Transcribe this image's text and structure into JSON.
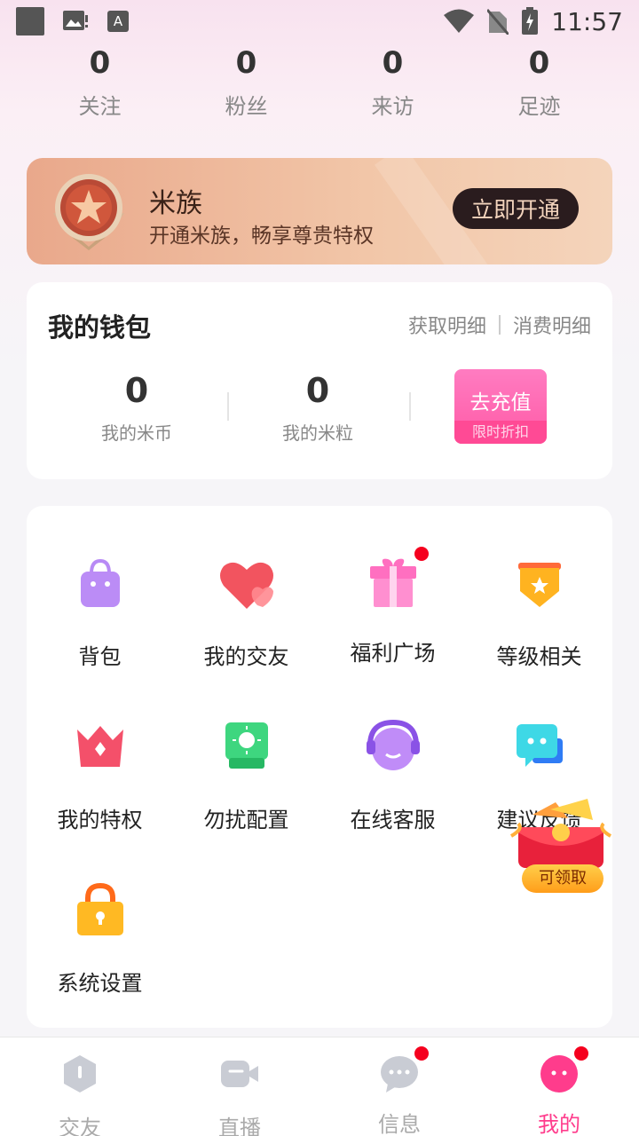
{
  "status_bar": {
    "time": "11:57"
  },
  "stats": [
    {
      "value": "0",
      "label": "关注"
    },
    {
      "value": "0",
      "label": "粉丝"
    },
    {
      "value": "0",
      "label": "来访"
    },
    {
      "value": "0",
      "label": "足迹"
    }
  ],
  "vip": {
    "title": "米族",
    "subtitle": "开通米族，畅享尊贵特权",
    "button": "立即开通"
  },
  "wallet": {
    "title": "我的钱包",
    "link_income": "获取明细",
    "link_spend": "消费明细",
    "coins_value": "0",
    "coins_label": "我的米币",
    "grains_value": "0",
    "grains_label": "我的米粒",
    "recharge_label": "去充值",
    "recharge_sub": "限时折扣"
  },
  "menu": {
    "items": [
      {
        "label": "背包",
        "icon": "bag-icon"
      },
      {
        "label": "我的交友",
        "icon": "heart-icon"
      },
      {
        "label": "福利广场",
        "icon": "gift-icon"
      },
      {
        "label": "等级相关",
        "icon": "level-badge-icon"
      },
      {
        "label": "我的特权",
        "icon": "crown-icon"
      },
      {
        "label": "勿扰配置",
        "icon": "do-not-disturb-icon"
      },
      {
        "label": "在线客服",
        "icon": "headset-icon"
      },
      {
        "label": "建议反馈",
        "icon": "feedback-icon"
      },
      {
        "label": "系统设置",
        "icon": "lock-icon"
      }
    ]
  },
  "reward": {
    "label": "可领取"
  },
  "tabs": [
    {
      "label": "交友",
      "icon": "friends-tab-icon",
      "active": false
    },
    {
      "label": "直播",
      "icon": "live-tab-icon",
      "active": false
    },
    {
      "label": "信息",
      "icon": "message-tab-icon",
      "active": false
    },
    {
      "label": "我的",
      "icon": "profile-tab-icon",
      "active": true
    }
  ],
  "colors": {
    "accent": "#ff3c8c",
    "badge_red": "#f5001e",
    "vip_bg": "#efbb9c"
  }
}
